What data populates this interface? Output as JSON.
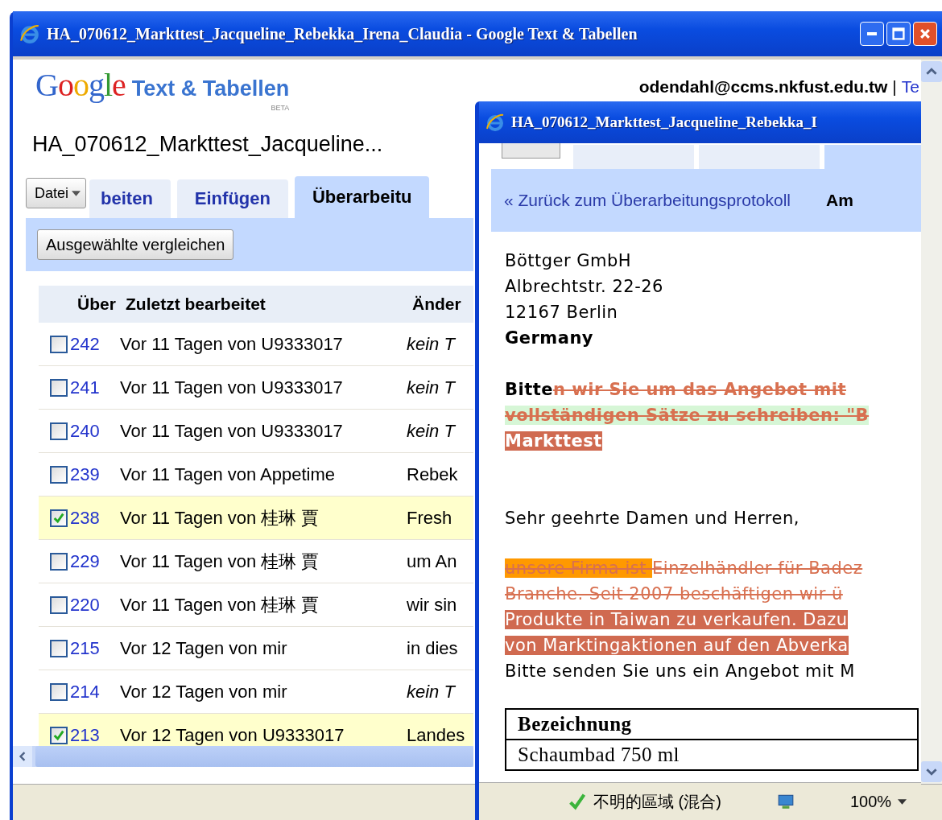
{
  "window": {
    "title": "HA_070612_Markttest_Jacqueline_Rebekka_Irena_Claudia - Google Text & Tabellen"
  },
  "header": {
    "logo_google": "Google",
    "logo_product": "Text & Tabellen",
    "logo_badge": "BETA",
    "user": "odendahl@ccms.nkfust.edu.tw",
    "separator": "|",
    "link": "Te"
  },
  "document_title": "HA_070612_Markttest_Jacqueline...",
  "file_menu": "Datei",
  "tabs": [
    {
      "label": "beiten",
      "selected": false
    },
    {
      "label": "Einfügen",
      "selected": false
    },
    {
      "label": "Überarbeitu",
      "selected": true
    }
  ],
  "compare_button": "Ausgewählte vergleichen",
  "table": {
    "columns": [
      "Über",
      "Zuletzt bearbeitet",
      "Änder"
    ],
    "rows": [
      {
        "checked": false,
        "revision": "242",
        "edited": "Vor 11 Tagen von U9333017",
        "change": "kein T",
        "italic": true
      },
      {
        "checked": false,
        "revision": "241",
        "edited": "Vor 11 Tagen von U9333017",
        "change": "kein T",
        "italic": true
      },
      {
        "checked": false,
        "revision": "240",
        "edited": "Vor 11 Tagen von U9333017",
        "change": "kein T",
        "italic": true
      },
      {
        "checked": false,
        "revision": "239",
        "edited": "Vor 11 Tagen von Appetime",
        "change": "Rebek",
        "italic": false
      },
      {
        "checked": true,
        "revision": "238",
        "edited": "Vor 11 Tagen von 桂琳 賈",
        "change": "Fresh",
        "italic": false
      },
      {
        "checked": false,
        "revision": "229",
        "edited": "Vor 11 Tagen von 桂琳 賈",
        "change": "um An",
        "italic": false
      },
      {
        "checked": false,
        "revision": "220",
        "edited": "Vor 11 Tagen von 桂琳 賈",
        "change": "wir sin",
        "italic": false
      },
      {
        "checked": false,
        "revision": "215",
        "edited": "Vor 12 Tagen von mir",
        "change": "in dies",
        "italic": false
      },
      {
        "checked": false,
        "revision": "214",
        "edited": "Vor 12 Tagen von mir",
        "change": "kein T",
        "italic": true
      },
      {
        "checked": true,
        "revision": "213",
        "edited": "Vor 12 Tagen von U9333017",
        "change": "Landes",
        "italic": false
      }
    ]
  },
  "popup": {
    "title": "HA_070612_Markttest_Jacqueline_Rebekka_I",
    "tabs": [
      {
        "selected": false
      },
      {
        "selected": false
      },
      {
        "selected": true
      }
    ],
    "back_link": "« Zurück zum Überarbeitungsprotokoll",
    "nav_label": "Am",
    "blocks": [
      [
        [
          {
            "kind": "plain",
            "text": "Böttger GmbH"
          }
        ],
        [
          {
            "kind": "plain",
            "text": "Albrechtstr. 22-26"
          }
        ],
        [
          {
            "kind": "plain",
            "text": "12167 Berlin"
          }
        ],
        [
          {
            "kind": "bold",
            "text": "Germany"
          }
        ]
      ],
      [
        [
          {
            "kind": "bold",
            "text": "Bitte"
          },
          {
            "kind": "deleted-bold",
            "text": "n wir Sie um das Angebot mit"
          }
        ],
        [
          {
            "kind": "deleted-green",
            "text": "vollständigen Sätze zu schreiben: \"B"
          }
        ],
        [
          {
            "kind": "inserted-bold",
            "text": "Markttest  "
          }
        ]
      ],
      [
        [
          {
            "kind": "plain",
            "text": "Sehr geehrte Damen und Herren,"
          }
        ]
      ],
      [
        [
          {
            "kind": "moved",
            "text": "unsere Firma ist "
          },
          {
            "kind": "deleted",
            "text": "Einzelhändler für Badez"
          }
        ],
        [
          {
            "kind": "deleted",
            "text": "Branche. Seit 2007 beschäftigen wir ü"
          }
        ],
        [
          {
            "kind": "inserted",
            "text": "Produkte in Taiwan zu verkaufen. Dazu"
          }
        ],
        [
          {
            "kind": "inserted",
            "text": "von Marktingaktionen auf den Abverka"
          }
        ],
        [
          {
            "kind": "plain",
            "text": "Bitte senden Sie uns ein Angebot mit M"
          }
        ]
      ]
    ],
    "table": {
      "header": "Bezeichnung",
      "rows": [
        "Schaumbad 750 ml"
      ]
    },
    "status_bar": {
      "zone": "不明的區域 (混合)",
      "zoom": "100%"
    }
  }
}
